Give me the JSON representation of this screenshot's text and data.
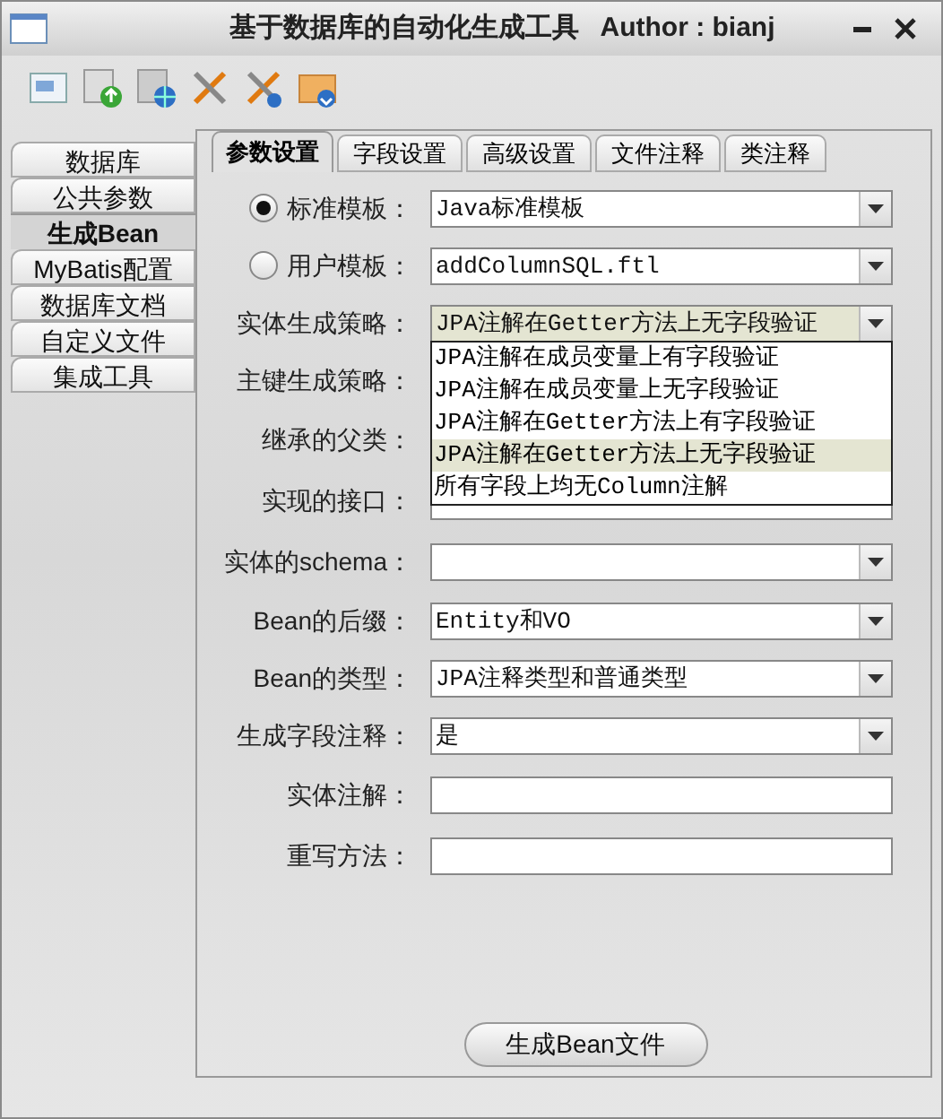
{
  "window": {
    "title": "基于数据库的自动化生成工具",
    "author": "Author : bianj"
  },
  "side_tabs": [
    {
      "label": "数据库",
      "selected": false
    },
    {
      "label": "公共参数",
      "selected": false
    },
    {
      "label": "生成Bean",
      "selected": true
    },
    {
      "label": "MyBatis配置",
      "selected": false
    },
    {
      "label": "数据库文档",
      "selected": false
    },
    {
      "label": "自定义文件",
      "selected": false
    },
    {
      "label": "集成工具",
      "selected": false
    }
  ],
  "tabs": [
    {
      "label": "参数设置",
      "selected": true
    },
    {
      "label": "字段设置",
      "selected": false
    },
    {
      "label": "高级设置",
      "selected": false
    },
    {
      "label": "文件注释",
      "selected": false
    },
    {
      "label": "类注释",
      "selected": false
    }
  ],
  "templates": [
    {
      "label": "标准模板：",
      "value": "Java标准模板",
      "selected": true
    },
    {
      "label": "用户模板：",
      "value": "addColumnSQL.ftl",
      "selected": false
    }
  ],
  "fields": [
    {
      "kind": "select",
      "label": "实体生成策略：",
      "value": "JPA注解在Getter方法上无字段验证",
      "expanded": true,
      "options": [
        {
          "label": "JPA注解在成员变量上有字段验证",
          "selected": false
        },
        {
          "label": "JPA注解在成员变量上无字段验证",
          "selected": false
        },
        {
          "label": "JPA注解在Getter方法上有字段验证",
          "selected": false
        },
        {
          "label": "JPA注解在Getter方法上无字段验证",
          "selected": true
        },
        {
          "label": "所有字段上均无Column注解",
          "selected": false
        }
      ]
    },
    {
      "kind": "hidden",
      "label": "主键生成策略："
    },
    {
      "kind": "hidden",
      "label": "继承的父类："
    },
    {
      "kind": "text",
      "label": "实现的接口："
    },
    {
      "kind": "select",
      "label": "实体的schema："
    },
    {
      "kind": "select",
      "label": "Bean的后缀：",
      "value": "Entity和VO"
    },
    {
      "kind": "select",
      "label": "Bean的类型：",
      "value": "JPA注释类型和普通类型"
    },
    {
      "kind": "select",
      "label": "生成字段注释：",
      "value": "是"
    },
    {
      "kind": "text",
      "label": "实体注解："
    },
    {
      "kind": "text",
      "label": "重写方法："
    }
  ],
  "generate_button": "生成Bean文件"
}
